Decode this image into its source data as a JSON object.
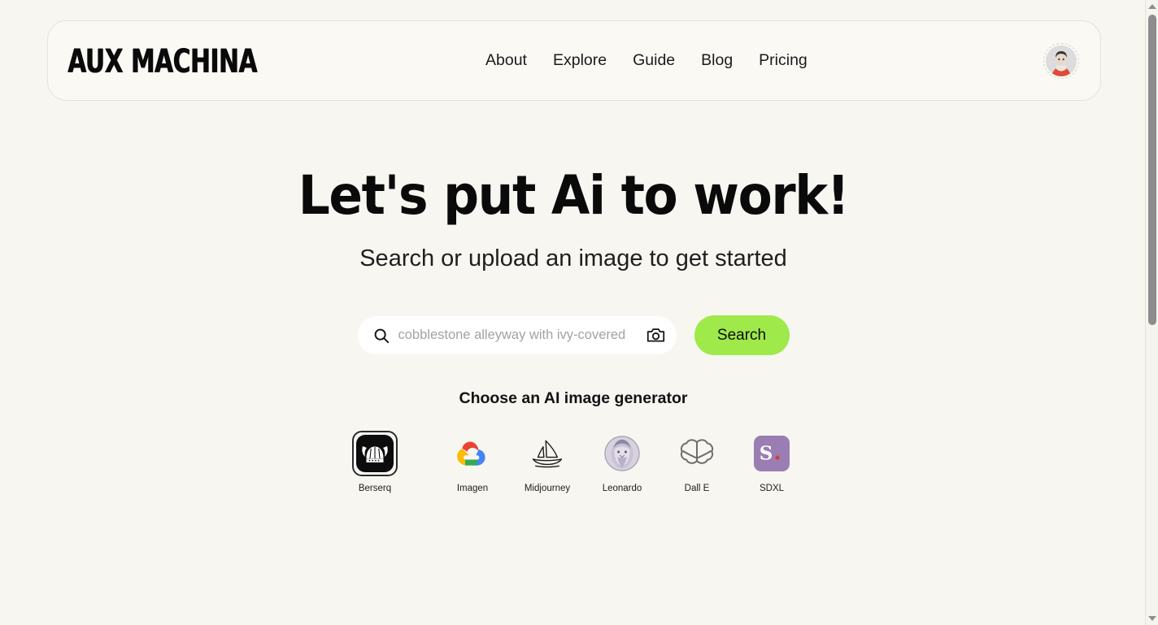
{
  "brand": {
    "logo_text": "AUX MACHINA"
  },
  "nav": {
    "items": [
      {
        "label": "About"
      },
      {
        "label": "Explore"
      },
      {
        "label": "Guide"
      },
      {
        "label": "Blog"
      },
      {
        "label": "Pricing"
      }
    ]
  },
  "account": {
    "avatar_alt": "user-avatar"
  },
  "hero": {
    "headline": "Let's put Ai to work!",
    "subhead": "Search or upload an image to get started"
  },
  "search": {
    "value": "",
    "placeholder": "cobblestone alleyway with ivy-covered",
    "search_icon": "search-icon",
    "camera_icon": "camera-icon",
    "button_label": "Search",
    "button_color": "#9fe94b"
  },
  "generators": {
    "title": "Choose an AI image generator",
    "selected": "Berserq",
    "items": [
      {
        "label": "Berserq",
        "icon": "viking-helmet-icon",
        "selected": true
      },
      {
        "label": "Imagen",
        "icon": "google-cloud-icon",
        "selected": false
      },
      {
        "label": "Midjourney",
        "icon": "sailboat-icon",
        "selected": false
      },
      {
        "label": "Leonardo",
        "icon": "davinci-portrait-icon",
        "selected": false
      },
      {
        "label": "Dall E",
        "icon": "openai-knot-icon",
        "selected": false
      },
      {
        "label": "SDXL",
        "icon": "stability-s-icon",
        "selected": false
      }
    ]
  },
  "scrollbar": {
    "up_icon": "scroll-up-arrow-icon",
    "down_icon": "scroll-down-arrow-icon"
  },
  "theme": {
    "page_background": "#f7f6f1",
    "header_background": "#faf9f4",
    "header_border": "#e6e2d9",
    "text": "#0a0a0a",
    "accent": "#9fe94b"
  }
}
